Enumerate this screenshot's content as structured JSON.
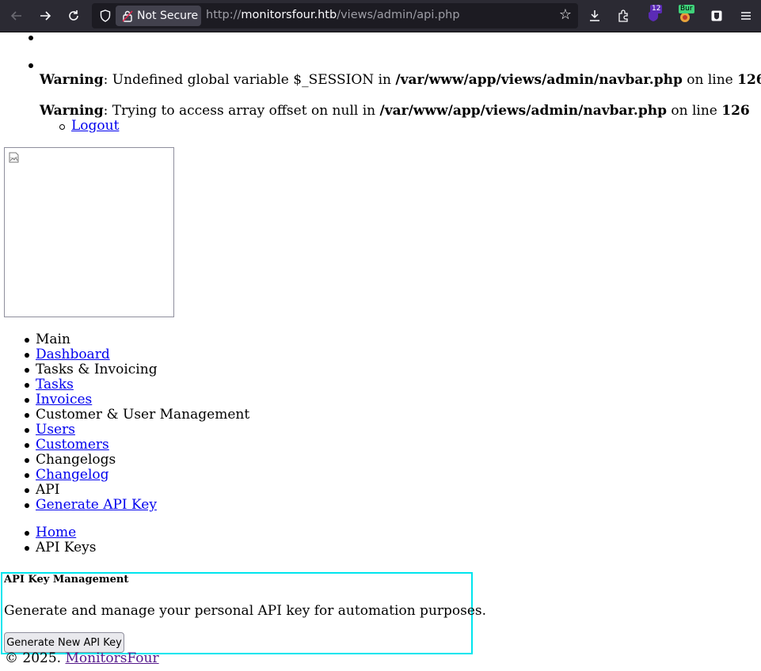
{
  "browser": {
    "security_label": "Not Secure",
    "url_scheme": "http://",
    "url_host": "monitorsfour.htb",
    "url_path": "/views/admin/api.php",
    "ext_ublock_badge": "12",
    "ext_burp_badge": "Bur",
    "icons": [
      "back-icon",
      "forward-icon",
      "reload-icon",
      "shield-icon",
      "lock-icon",
      "bookmark-star-icon",
      "download-icon",
      "extensions-icon",
      "ublock-icon",
      "burp-icon",
      "bitwarden-icon",
      "menu-icon"
    ]
  },
  "warnings": [
    {
      "label": "Warning",
      "message": ": Undefined global variable $_SESSION in ",
      "file": "/var/www/app/views/admin/navbar.php",
      "on_line": " on line ",
      "line": "126"
    },
    {
      "label": "Warning",
      "message": ": Trying to access array offset on null in ",
      "file": "/var/www/app/views/admin/navbar.php",
      "on_line": " on line ",
      "line": "126"
    }
  ],
  "top_nav": {
    "logout_label": "Logout"
  },
  "sidebar": {
    "items": [
      {
        "label": "Main",
        "link": false
      },
      {
        "label": "Dashboard",
        "link": true
      },
      {
        "label": "Tasks & Invoicing",
        "link": false
      },
      {
        "label": "Tasks",
        "link": true
      },
      {
        "label": "Invoices",
        "link": true
      },
      {
        "label": "Customer & User Management",
        "link": false
      },
      {
        "label": "Users",
        "link": true
      },
      {
        "label": "Customers",
        "link": true
      },
      {
        "label": "Changelogs",
        "link": false
      },
      {
        "label": "Changelog",
        "link": true
      },
      {
        "label": "API",
        "link": false
      },
      {
        "label": "Generate API Key",
        "link": true
      }
    ]
  },
  "breadcrumb": {
    "home_label": "Home",
    "current_label": "API Keys"
  },
  "api_card": {
    "title": "API Key Management",
    "description": "Generate and manage your personal API key for automation purposes.",
    "button_label": "Generate New API Key"
  },
  "footer": {
    "copyright": "© 2025. ",
    "brand_link": "MonitorsFour"
  },
  "colors": {
    "highlight_border": "#00e5ee",
    "link": "#0000ee",
    "visited_link": "#551a8b",
    "toolbar_bg": "#2b2a33"
  }
}
